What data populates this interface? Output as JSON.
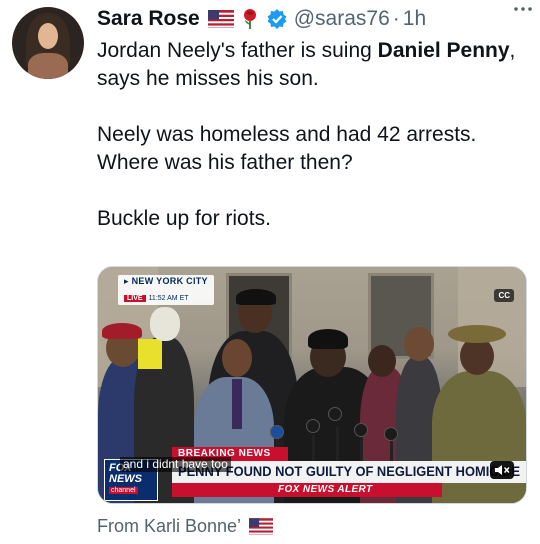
{
  "author": {
    "name": "Sara Rose",
    "handle": "@saras76",
    "separator": "·",
    "time": "1h"
  },
  "tweet": {
    "line1_pre": "Jordan Neely's father is suing ",
    "line1_bold": "Daniel Penny",
    "line1_post": ", says he misses his son.",
    "paragraph2": "Neely was  homeless and had 42 arrests. Where was his father then?",
    "paragraph3": "Buckle up for riots."
  },
  "media": {
    "location": "NEW YORK CITY",
    "live_tag": "LIVE",
    "live_time": "11:52 AM ET",
    "cc_label": "CC",
    "breaking_label": "BREAKING NEWS",
    "headline": "PENNY FOUND NOT GUILTY OF NEGLIGENT HOMICIDE",
    "alert": "FOX NEWS ALERT",
    "caption": "and i didnt have too",
    "logo_fox": "FOX",
    "logo_news": "NEWS",
    "logo_channel": "channel",
    "mute_icon": "speaker-muted-icon"
  },
  "footer": {
    "source_text": "From Karli Bonne’"
  },
  "colors": {
    "text_primary": "#0f1419",
    "text_secondary": "#536471",
    "verified_blue": "#1d9bf0",
    "fox_red": "#c8102e",
    "fox_navy": "#0a2d6e"
  }
}
